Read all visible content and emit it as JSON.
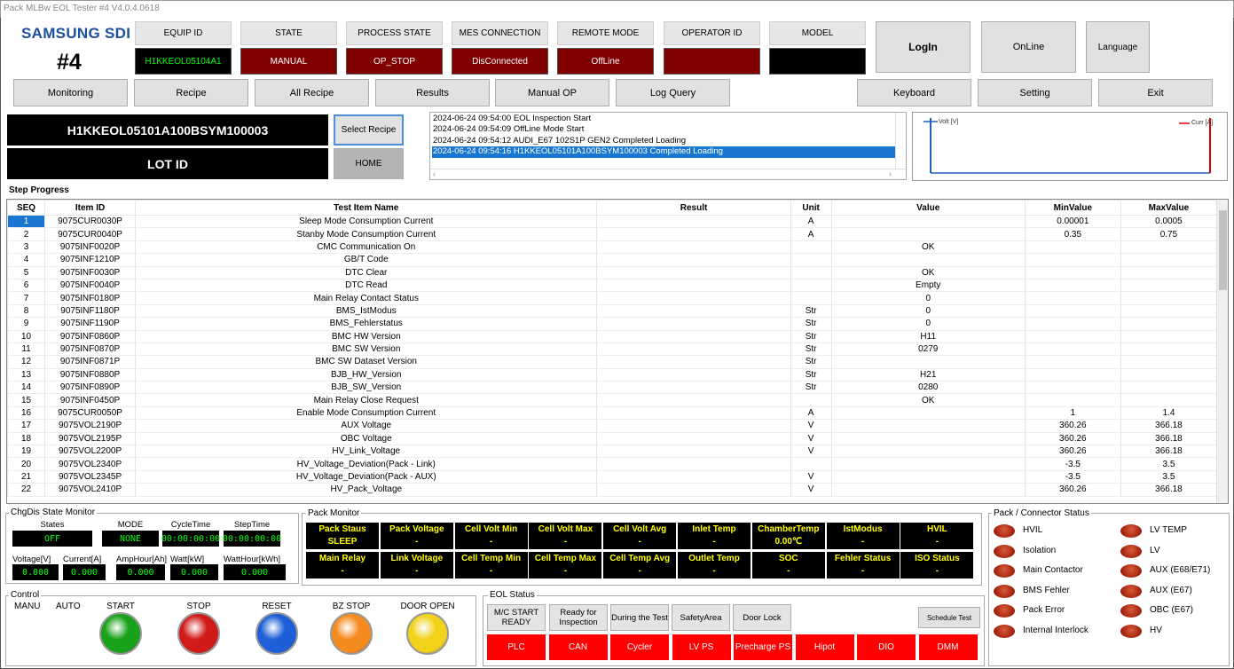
{
  "window": {
    "title": "Pack MLBw EOL Tester #4 V4.0.4.0618"
  },
  "brand": {
    "logo": "SAMSUNG SDI",
    "station": "#4"
  },
  "status_header": [
    {
      "label": "EQUIP ID",
      "value": "H1KKEOL05104A1",
      "bg": "#000000",
      "fg": "#00ff00"
    },
    {
      "label": "STATE",
      "value": "MANUAL",
      "bg": "#800000",
      "fg": "#ffffff"
    },
    {
      "label": "PROCESS STATE",
      "value": "OP_STOP",
      "bg": "#800000",
      "fg": "#ffffff"
    },
    {
      "label": "MES CONNECTION",
      "value": "DisConnected",
      "bg": "#800000",
      "fg": "#ffffff"
    },
    {
      "label": "REMOTE MODE",
      "value": "OffLine",
      "bg": "#800000",
      "fg": "#ffffff"
    },
    {
      "label": "OPERATOR ID",
      "value": "",
      "bg": "#800000",
      "fg": "#ffffff"
    },
    {
      "label": "MODEL",
      "value": "",
      "bg": "#000000",
      "fg": "#ffffff"
    }
  ],
  "top_buttons": {
    "login": "LogIn",
    "online": "OnLine",
    "language": "Language"
  },
  "nav": [
    "Monitoring",
    "Recipe",
    "All Recipe",
    "Results",
    "Manual OP",
    "Log Query"
  ],
  "nav_right": [
    "Keyboard",
    "Setting",
    "Exit"
  ],
  "recipe": {
    "barcode": "H1KKEOL05101A100BSYM100003",
    "lot": "LOT ID",
    "select_recipe": "Select Recipe",
    "home": "HOME"
  },
  "log": [
    "2024-06-24 09:54:00 EOL Inspection Start",
    "2024-06-24 09:54:09 OffLine Mode Start",
    "2024-06-24 09:54:12 AUDI_E67 102S1P GEN2 Completed Loading",
    "2024-06-24 09:54:16 H1KKEOL05101A100BSYM100003 Completed Loading"
  ],
  "mini_chart": {
    "legend_left": "Volt [V]",
    "legend_right": "Curr [A]",
    "left_color": "#1f5fbf",
    "right_color": "#e00000"
  },
  "step_progress": {
    "title": "Step Progress",
    "columns": [
      "SEQ",
      "Item ID",
      "Test Item Name",
      "Result",
      "Unit",
      "Value",
      "MinValue",
      "MaxValue"
    ],
    "rows": [
      [
        "1",
        "9075CUR0030P",
        "Sleep Mode Consumption Current",
        "",
        "A",
        "",
        "0.00001",
        "0.0005"
      ],
      [
        "2",
        "9075CUR0040P",
        "Stanby Mode Consumption Current",
        "",
        "A",
        "",
        "0.35",
        "0.75"
      ],
      [
        "3",
        "9075INF0020P",
        "CMC Communication On",
        "",
        "",
        "OK",
        "",
        ""
      ],
      [
        "4",
        "9075INF1210P",
        "GB/T Code",
        "",
        "",
        "",
        "",
        ""
      ],
      [
        "5",
        "9075INF0030P",
        "DTC Clear",
        "",
        "",
        "OK",
        "",
        ""
      ],
      [
        "6",
        "9075INF0040P",
        "DTC Read",
        "",
        "",
        "Empty",
        "",
        ""
      ],
      [
        "7",
        "9075INF0180P",
        "Main Relay Contact Status",
        "",
        "",
        "0",
        "",
        ""
      ],
      [
        "8",
        "9075INF1180P",
        "BMS_IstModus",
        "",
        "Str",
        "0",
        "",
        ""
      ],
      [
        "9",
        "9075INF1190P",
        "BMS_Fehlerstatus",
        "",
        "Str",
        "0",
        "",
        ""
      ],
      [
        "10",
        "9075INF0860P",
        "BMC HW Version",
        "",
        "Str",
        "H11",
        "",
        ""
      ],
      [
        "11",
        "9075INF0870P",
        "BMC SW Version",
        "",
        "Str",
        "0279",
        "",
        ""
      ],
      [
        "12",
        "9075INF0871P",
        "BMC SW Dataset Version",
        "",
        "Str",
        "",
        "",
        ""
      ],
      [
        "13",
        "9075INF0880P",
        "BJB_HW_Version",
        "",
        "Str",
        "H21",
        "",
        ""
      ],
      [
        "14",
        "9075INF0890P",
        "BJB_SW_Version",
        "",
        "Str",
        "0280",
        "",
        ""
      ],
      [
        "15",
        "9075INF0450P",
        "Main Relay Close Request",
        "",
        "",
        "OK",
        "",
        ""
      ],
      [
        "16",
        "9075CUR0050P",
        "Enable Mode Consumption Current",
        "",
        "A",
        "",
        "1",
        "1.4"
      ],
      [
        "17",
        "9075VOL2190P",
        "AUX Voltage",
        "",
        "V",
        "",
        "360.26",
        "366.18"
      ],
      [
        "18",
        "9075VOL2195P",
        "OBC Voltage",
        "",
        "V",
        "",
        "360.26",
        "366.18"
      ],
      [
        "19",
        "9075VOL2200P",
        "HV_Link_Voltage",
        "",
        "V",
        "",
        "360.26",
        "366.18"
      ],
      [
        "20",
        "9075VOL2340P",
        "HV_Voltage_Deviation(Pack - Link)",
        "",
        "",
        "",
        "-3.5",
        "3.5"
      ],
      [
        "21",
        "9075VOL2345P",
        "HV_Voltage_Deviation(Pack - AUX)",
        "",
        "V",
        "",
        "-3.5",
        "3.5"
      ],
      [
        "22",
        "9075VOL2410P",
        "HV_Pack_Voltage",
        "",
        "V",
        "",
        "360.26",
        "366.18"
      ]
    ]
  },
  "chgdis": {
    "title": "ChgDis State Monitor",
    "labels": [
      "States",
      "MODE",
      "CycleTime",
      "StepTime"
    ],
    "values": [
      "OFF",
      "NONE",
      "00:00:00:00",
      "00:00:00:00"
    ],
    "labels2": [
      "Voltage[V]",
      "Current[A]",
      "AmpHour[Ah]",
      "Watt[kW]",
      "WattHour[kWh]"
    ],
    "values2": [
      "0.000",
      "0.000",
      "0.000",
      "0.000",
      "0.000"
    ]
  },
  "control": {
    "title": "Control",
    "manu": "MANU",
    "auto": "AUTO",
    "buttons": [
      {
        "label": "START",
        "color": "#1aa11a"
      },
      {
        "label": "STOP",
        "color": "#d11b1b"
      },
      {
        "label": "RESET",
        "color": "#1e5fd8"
      },
      {
        "label": "BZ STOP",
        "color": "#f58a1f"
      },
      {
        "label": "DOOR OPEN",
        "color": "#f2d21b"
      }
    ]
  },
  "pack_monitor": {
    "title": "Pack Monitor",
    "row1": [
      [
        "Pack Staus",
        "SLEEP"
      ],
      [
        "Pack Voltage",
        "-"
      ],
      [
        "Cell Volt Min",
        "-"
      ],
      [
        "Cell Volt Max",
        "-"
      ],
      [
        "Cell Volt Avg",
        "-"
      ],
      [
        "Inlet Temp",
        "-"
      ],
      [
        "ChamberTemp",
        "0.00℃"
      ],
      [
        "IstModus",
        "-"
      ],
      [
        "HVIL",
        "-"
      ]
    ],
    "row2": [
      [
        "Main Relay",
        "-"
      ],
      [
        "Link Voltage",
        "-"
      ],
      [
        "Cell Temp Min",
        "-"
      ],
      [
        "Cell Temp Max",
        "-"
      ],
      [
        "Cell Temp Avg",
        "-"
      ],
      [
        "Outlet Temp",
        "-"
      ],
      [
        "SOC",
        "-"
      ],
      [
        "Fehler Status",
        "-"
      ],
      [
        "ISO Status",
        "-"
      ]
    ]
  },
  "eol": {
    "title": "EOL Status",
    "states": [
      "M/C START READY",
      "Ready for Inspection",
      "During the Test",
      "SafetyArea",
      "Door Lock"
    ],
    "schedule": "Schedule Test",
    "devices": [
      "PLC",
      "CAN",
      "Cycler",
      "LV PS",
      "Precharge PS",
      "Hipot",
      "DIO",
      "DMM"
    ]
  },
  "connector": {
    "title": "Pack / Connector Status",
    "left": [
      "HVIL",
      "Isolation",
      "Main Contactor",
      "BMS Fehler",
      "Pack Error",
      "Internal Interlock"
    ],
    "right": [
      "LV TEMP",
      "LV",
      "AUX (E68/E71)",
      "AUX (E67)",
      "OBC (E67)",
      "HV"
    ]
  }
}
